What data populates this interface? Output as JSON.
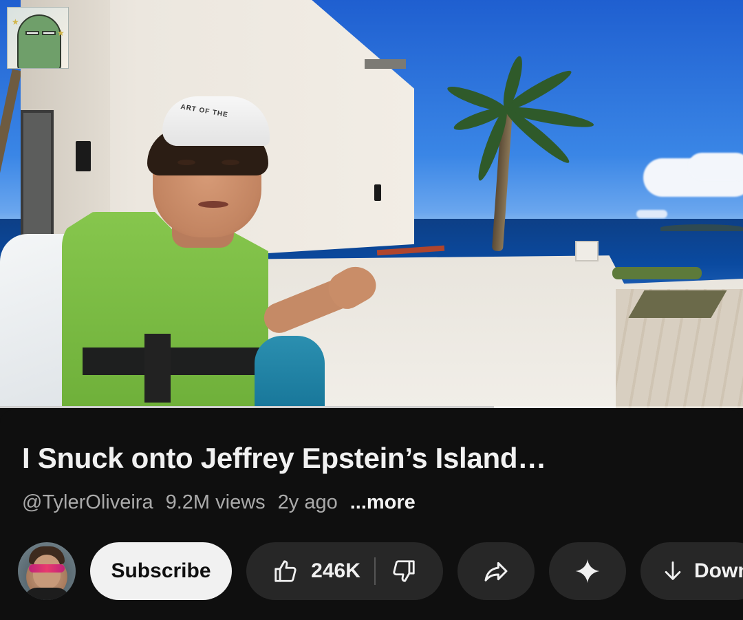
{
  "video": {
    "cap_print": "ART OF THE",
    "progress_fraction": 0.665
  },
  "info": {
    "title": "I Snuck onto Jeffrey Epstein’s Island…",
    "channel_handle": "@TylerOliveira",
    "views": "9.2M views",
    "age": "2y ago",
    "more_label": "...more"
  },
  "actions": {
    "subscribe_label": "Subscribe",
    "like_count": "246K",
    "download_label": "Down"
  },
  "icons": {
    "like": "thumbs-up-icon",
    "dislike": "thumbs-down-icon",
    "share": "share-arrow-icon",
    "ask": "sparkle-icon",
    "download": "download-arrow-icon"
  },
  "colors": {
    "background": "#0f0f0f",
    "pill": "#272727",
    "subscribe_bg": "#f1f1f1",
    "secondary_text": "#aaaaaa"
  }
}
